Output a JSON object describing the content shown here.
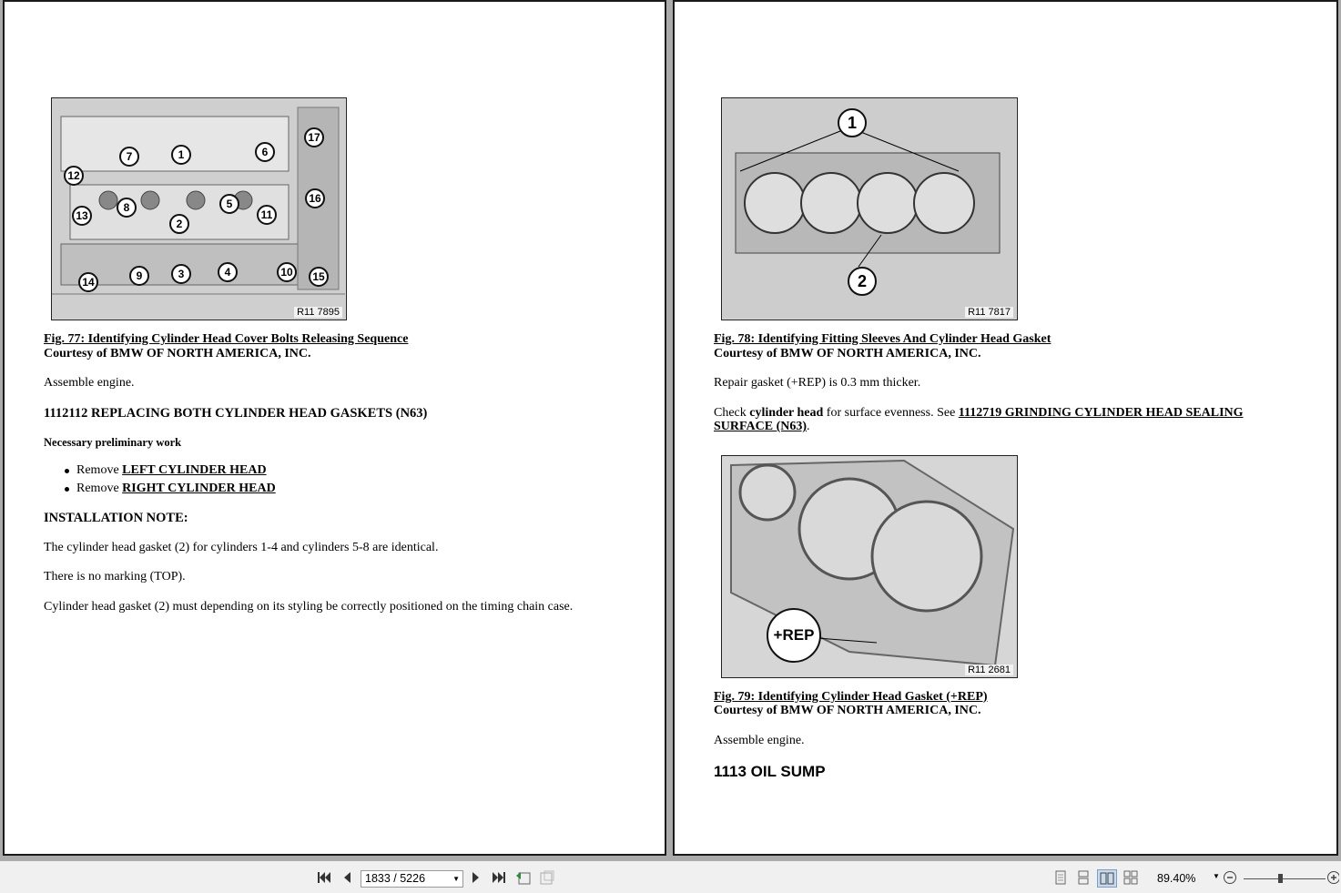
{
  "left_page": {
    "fig77": {
      "image_id": "R11 7895",
      "callouts": [
        "1",
        "2",
        "3",
        "4",
        "5",
        "6",
        "7",
        "8",
        "9",
        "10",
        "11",
        "12",
        "13",
        "14",
        "15",
        "16",
        "17"
      ],
      "caption": "Fig. 77: Identifying Cylinder Head Cover Bolts Releasing Sequence",
      "courtesy": "Courtesy of BMW OF NORTH AMERICA, INC."
    },
    "p_assemble": "Assemble engine.",
    "heading": "1112112 REPLACING BOTH CYLINDER HEAD GASKETS (N63)",
    "prelim": "Necessary preliminary work",
    "bullets": [
      {
        "prefix": "Remove ",
        "link": "LEFT CYLINDER HEAD"
      },
      {
        "prefix": "Remove ",
        "link": "RIGHT CYLINDER HEAD"
      }
    ],
    "install_note": "INSTALLATION NOTE:",
    "p1": "The cylinder head gasket (2) for cylinders 1-4 and cylinders 5-8 are identical.",
    "p2": "There is no marking (TOP).",
    "p3": "Cylinder head gasket (2) must depending on its styling be correctly positioned on the timing chain case."
  },
  "right_page": {
    "fig78": {
      "image_id": "R11 7817",
      "callouts": [
        "1",
        "2"
      ],
      "caption": "Fig. 78: Identifying Fitting Sleeves And Cylinder Head Gasket",
      "courtesy": "Courtesy of BMW OF NORTH AMERICA, INC."
    },
    "p_repair": "Repair gasket (+REP) is 0.3 mm thicker.",
    "check_prefix": "Check ",
    "check_bold": "cylinder head",
    "check_mid": " for surface evenness. See ",
    "check_link_line1": "1112719 GRINDING CYLINDER HEAD SEALING",
    "check_link_line2": "SURFACE (N63)",
    "check_end": ".",
    "fig79": {
      "image_id": "R11 2681",
      "callout": "+REP",
      "caption": "Fig. 79: Identifying Cylinder Head Gasket (+REP)",
      "courtesy": "Courtesy of BMW OF NORTH AMERICA, INC."
    },
    "p_assemble": "Assemble engine.",
    "section": "1113 OIL SUMP"
  },
  "toolbar": {
    "page_indicator": "1833 / 5226",
    "zoom": "89.40%",
    "icons": [
      "first-page-icon",
      "prev-page-icon",
      "next-page-icon",
      "last-page-icon",
      "go-back-icon",
      "go-forward-icon",
      "single-page-icon",
      "continuous-icon",
      "two-page-icon",
      "two-page-continuous-icon",
      "zoom-out-icon",
      "zoom-in-icon"
    ]
  }
}
